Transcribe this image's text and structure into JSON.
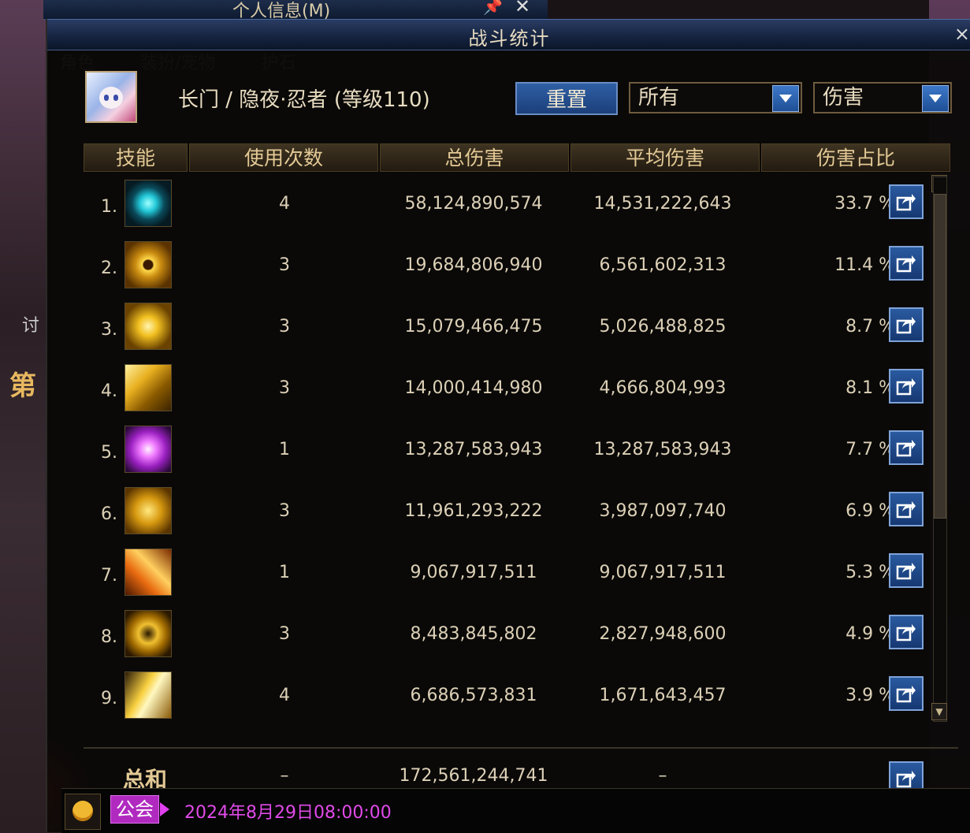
{
  "background": {
    "behind_window_title": "个人信息(M)",
    "behind_tabs": [
      "角色",
      "装扮/宠物",
      "护石"
    ],
    "left_text_1": "讨",
    "left_text_2": "第"
  },
  "window": {
    "title": "战斗统计",
    "close_glyph": "×",
    "character": "长门 / 隐夜·忍者 (等级110)",
    "reset_label": "重置",
    "filter_target": "所有",
    "filter_type": "伤害"
  },
  "table": {
    "headers": [
      "技能",
      "使用次数",
      "总伤害",
      "平均伤害",
      "伤害占比"
    ],
    "rows": [
      {
        "index": "1.",
        "icon": "cyan-vortex-skill-icon",
        "count": "4",
        "total": "58,124,890,574",
        "average": "14,531,222,643",
        "percent": "33.7 %"
      },
      {
        "index": "2.",
        "icon": "golden-eye-skill-icon",
        "count": "3",
        "total": "19,684,806,940",
        "average": "6,561,602,313",
        "percent": "11.4 %"
      },
      {
        "index": "3.",
        "icon": "golden-burst-skill-icon",
        "count": "3",
        "total": "15,079,466,475",
        "average": "5,026,488,825",
        "percent": "8.7 %"
      },
      {
        "index": "4.",
        "icon": "golden-beast-skill-icon",
        "count": "3",
        "total": "14,000,414,980",
        "average": "4,666,804,993",
        "percent": "8.1 %"
      },
      {
        "index": "5.",
        "icon": "purple-explosion-skill-icon",
        "count": "1",
        "total": "13,287,583,943",
        "average": "13,287,583,943",
        "percent": "7.7 %"
      },
      {
        "index": "6.",
        "icon": "golden-lion-skill-icon",
        "count": "3",
        "total": "11,961,293,222",
        "average": "3,987,097,740",
        "percent": "6.9 %"
      },
      {
        "index": "7.",
        "icon": "flame-swirl-skill-icon",
        "count": "1",
        "total": "9,067,917,511",
        "average": "9,067,917,511",
        "percent": "5.3 %"
      },
      {
        "index": "8.",
        "icon": "golden-spiral-skill-icon",
        "count": "3",
        "total": "8,483,845,802",
        "average": "2,827,948,600",
        "percent": "4.9 %"
      },
      {
        "index": "9.",
        "icon": "golden-strike-skill-icon",
        "count": "4",
        "total": "6,686,573,831",
        "average": "1,671,643,457",
        "percent": "3.9 %"
      }
    ],
    "sum": {
      "label": "总和",
      "count": "–",
      "total": "172,561,244,741",
      "average": "–"
    }
  },
  "chat": {
    "channel": "公会",
    "message": "2024年8月29日08:00:00"
  },
  "colors": {
    "header_text": "#e3c995",
    "button_blue": "#2a5aa0",
    "guild_magenta": "#b02ac0"
  }
}
